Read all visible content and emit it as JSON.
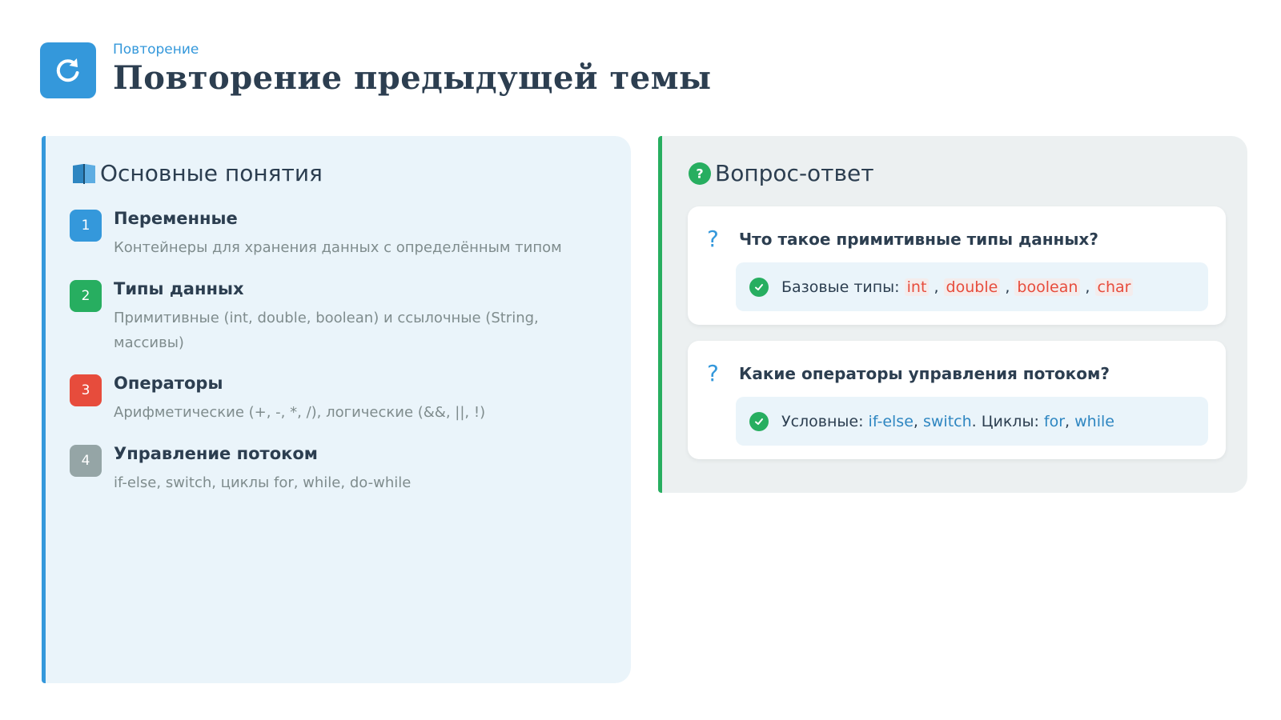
{
  "header": {
    "kicker": "Повторение",
    "title": "Повторение предыдущей темы",
    "icon": "refresh-icon",
    "accent": "#3498db"
  },
  "concepts": {
    "title": "Основные понятия",
    "icon": "book-icon",
    "items": [
      {
        "num": "1",
        "title": "Переменные",
        "desc": "Контейнеры для хранения данных с определённым типом",
        "color": "#3498db"
      },
      {
        "num": "2",
        "title": "Типы данных",
        "desc": "Примитивные (int, double, boolean) и ссылочные (String, массивы)",
        "color": "#27ae60"
      },
      {
        "num": "3",
        "title": "Операторы",
        "desc": "Арифметические (+, -, *, /), логические (&&, ||, !)",
        "color": "#e74c3c"
      },
      {
        "num": "4",
        "title": "Управление потоком",
        "desc": "if-else, switch, циклы for, while, do-while",
        "color": "#95a5a6"
      }
    ]
  },
  "qa": {
    "title": "Вопрос-ответ",
    "icon": "question-circle-icon",
    "accent": "#27ae60",
    "items": [
      {
        "question": "Что такое примитивные типы данных?",
        "answer": {
          "prefix": "Базовые типы: ",
          "types": [
            "int",
            "double",
            "boolean",
            "char"
          ],
          "sep": " , "
        }
      },
      {
        "question": "Какие операторы управления потоком?",
        "answer": {
          "cond_label": "Условные: ",
          "cond_1": "if-else",
          "comma_1": ", ",
          "cond_2": "switch",
          "loops_label": ". Циклы: ",
          "loop_1": "for",
          "comma_2": ", ",
          "loop_2": "while"
        }
      }
    ]
  }
}
